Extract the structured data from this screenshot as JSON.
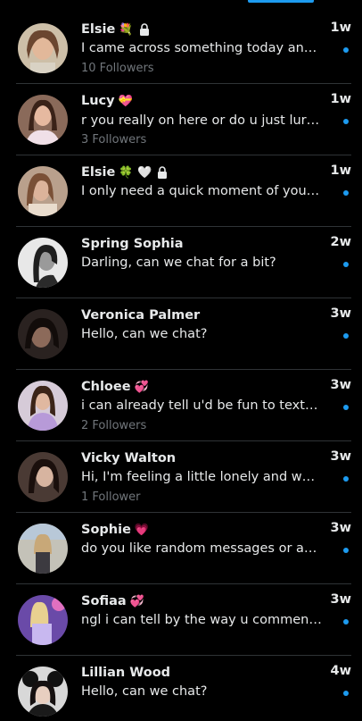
{
  "colors": {
    "background": "#000000",
    "accent": "#1d9bf0",
    "divider": "#2f3336",
    "muted": "#71767b"
  },
  "conversations": [
    {
      "name": "Elsie",
      "emojis": "💐",
      "locked": true,
      "time": "1w",
      "message": "I came across something today and ...",
      "followers": "10 Followers",
      "unread": true
    },
    {
      "name": "Lucy",
      "emojis": "💝",
      "locked": false,
      "time": "1w",
      "message": "r you really on here or do u just lurk 🙄",
      "followers": "3 Followers",
      "unread": true
    },
    {
      "name": "Elsie",
      "emojis": "🍀 🤍",
      "locked": true,
      "time": "1w",
      "message": "I only need a quick moment of your ...",
      "followers": "",
      "unread": true
    },
    {
      "name": "Spring Sophia",
      "emojis": "",
      "locked": false,
      "time": "2w",
      "message": "Darling, can we chat for a bit?",
      "followers": "",
      "unread": true
    },
    {
      "name": "Veronica Palmer",
      "emojis": "",
      "locked": false,
      "time": "3w",
      "message": "Hello, can we chat?",
      "followers": "",
      "unread": true
    },
    {
      "name": "Chloee",
      "emojis": "💞",
      "locked": false,
      "time": "3w",
      "message": "i can already tell u'd be fun to text ngl",
      "followers": "2 Followers",
      "unread": true
    },
    {
      "name": "Vicky Walton",
      "emojis": "",
      "locked": false,
      "time": "3w",
      "message": "Hi, I'm feeling a little lonely and want ...",
      "followers": "1 Follower",
      "unread": true
    },
    {
      "name": "Sophie",
      "emojis": "💗",
      "locked": false,
      "time": "3w",
      "message": "do you like random messages or are ...",
      "followers": "",
      "unread": true
    },
    {
      "name": "Sofiaa",
      "emojis": "💞",
      "locked": false,
      "time": "3w",
      "message": "ngl i can tell by the way u comment o...",
      "followers": "",
      "unread": true
    },
    {
      "name": "Lillian Wood",
      "emojis": "",
      "locked": false,
      "time": "4w",
      "message": "Hello, can we chat?",
      "followers": "",
      "unread": true
    }
  ]
}
